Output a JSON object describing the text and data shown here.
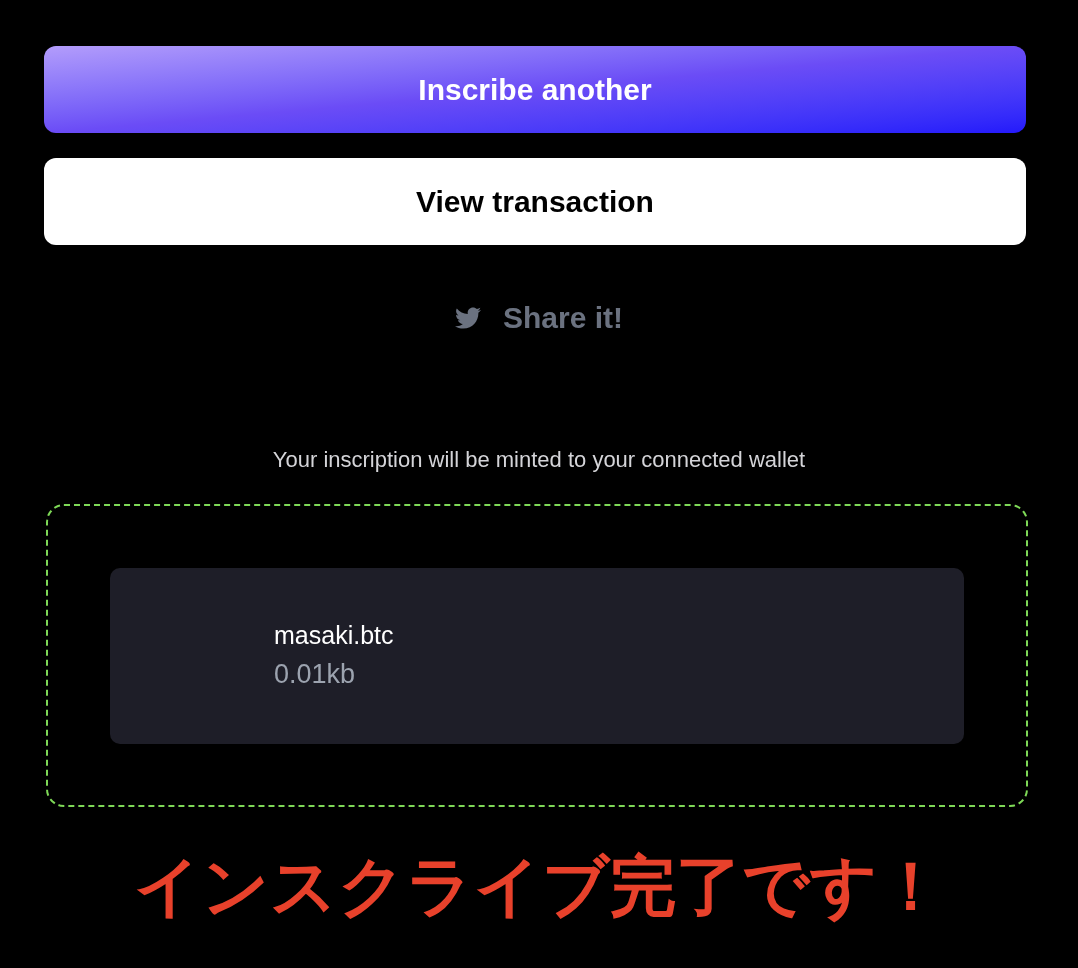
{
  "buttons": [
    {
      "label": "Inscribe another",
      "kind": "primary"
    },
    {
      "label": "View transaction",
      "kind": "secondary"
    }
  ],
  "share": {
    "label": "Share it!"
  },
  "notice": "Your inscription will be minted to your connected wallet",
  "inscription": {
    "name": "masaki.btc",
    "size": "0.01kb"
  },
  "caption": "インスクライブ完了です！"
}
